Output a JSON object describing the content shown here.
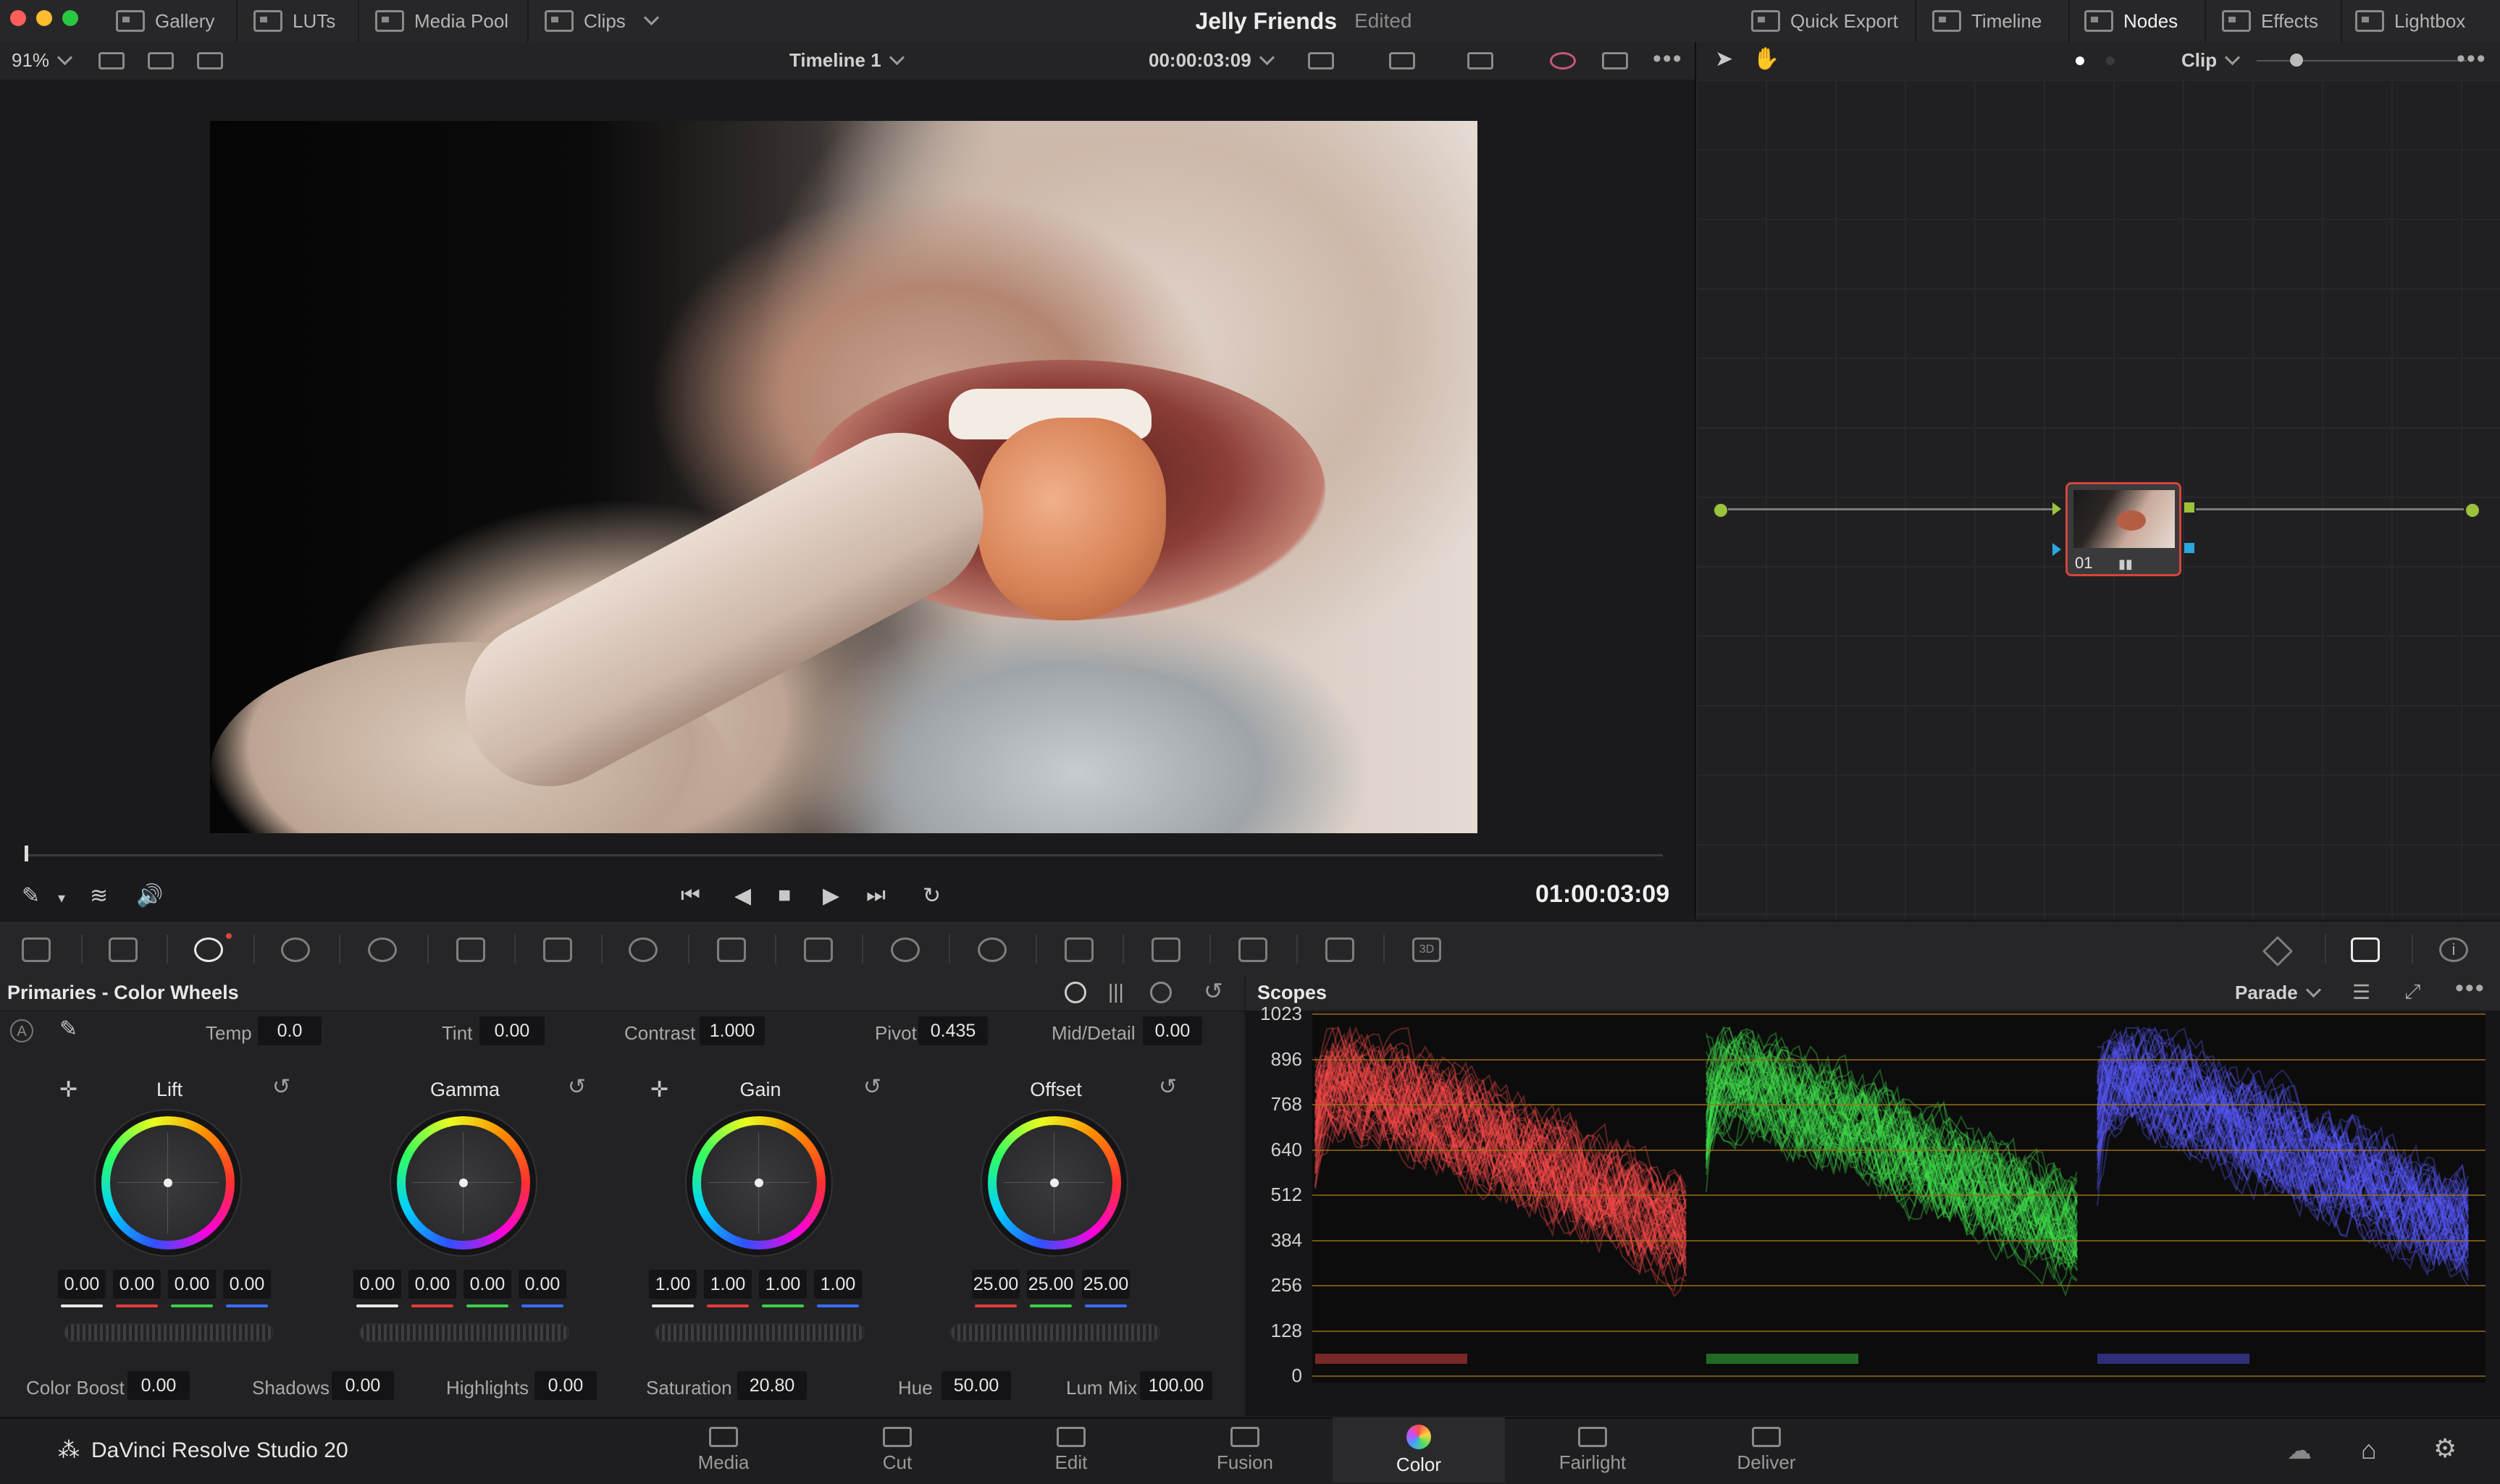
{
  "titlebar": {
    "modules_left": [
      "Gallery",
      "LUTs",
      "Media Pool",
      "Clips"
    ],
    "project_name": "Jelly Friends",
    "project_state": "Edited",
    "modules_right": [
      "Quick Export",
      "Timeline",
      "Nodes",
      "Effects",
      "Lightbox"
    ]
  },
  "viewer_toolbar": {
    "zoom": "91%",
    "timeline_name": "Timeline 1",
    "timecode_field": "00:00:03:09"
  },
  "viewer": {
    "timecode": "01:00:03:09"
  },
  "nodes": {
    "mode": "Clip",
    "node_label": "01"
  },
  "primaries": {
    "title": "Primaries - Color Wheels",
    "temp": {
      "label": "Temp",
      "value": "0.0"
    },
    "tint": {
      "label": "Tint",
      "value": "0.00"
    },
    "contrast": {
      "label": "Contrast",
      "value": "1.000"
    },
    "pivot": {
      "label": "Pivot",
      "value": "0.435"
    },
    "middetail": {
      "label": "Mid/Detail",
      "value": "0.00"
    },
    "wheels": [
      {
        "name": "Lift",
        "values": [
          "0.00",
          "0.00",
          "0.00",
          "0.00"
        ]
      },
      {
        "name": "Gamma",
        "values": [
          "0.00",
          "0.00",
          "0.00",
          "0.00"
        ]
      },
      {
        "name": "Gain",
        "values": [
          "1.00",
          "1.00",
          "1.00",
          "1.00"
        ]
      },
      {
        "name": "Offset",
        "values": [
          "25.00",
          "25.00",
          "25.00"
        ]
      }
    ],
    "colorboost": {
      "label": "Color Boost",
      "value": "0.00"
    },
    "shadows": {
      "label": "Shadows",
      "value": "0.00"
    },
    "highlights": {
      "label": "Highlights",
      "value": "0.00"
    },
    "saturation": {
      "label": "Saturation",
      "value": "20.80"
    },
    "hue": {
      "label": "Hue",
      "value": "50.00"
    },
    "lummix": {
      "label": "Lum Mix",
      "value": "100.00"
    }
  },
  "scopes": {
    "title": "Scopes",
    "mode": "Parade",
    "ticks": [
      "1023",
      "896",
      "768",
      "640",
      "512",
      "384",
      "256",
      "128",
      "0"
    ],
    "channel_colors": [
      "#ff4a4a",
      "#3ee04a",
      "#5a5aff"
    ]
  },
  "pagebar": {
    "brand": "DaVinci Resolve Studio 20",
    "pages": [
      "Media",
      "Cut",
      "Edit",
      "Fusion",
      "Color",
      "Fairlight",
      "Deliver"
    ],
    "active_page": "Color"
  },
  "colors": {
    "accent_red": "#d6453a",
    "node_pin": "#9bc23a",
    "grid_line": "#a2751a"
  }
}
